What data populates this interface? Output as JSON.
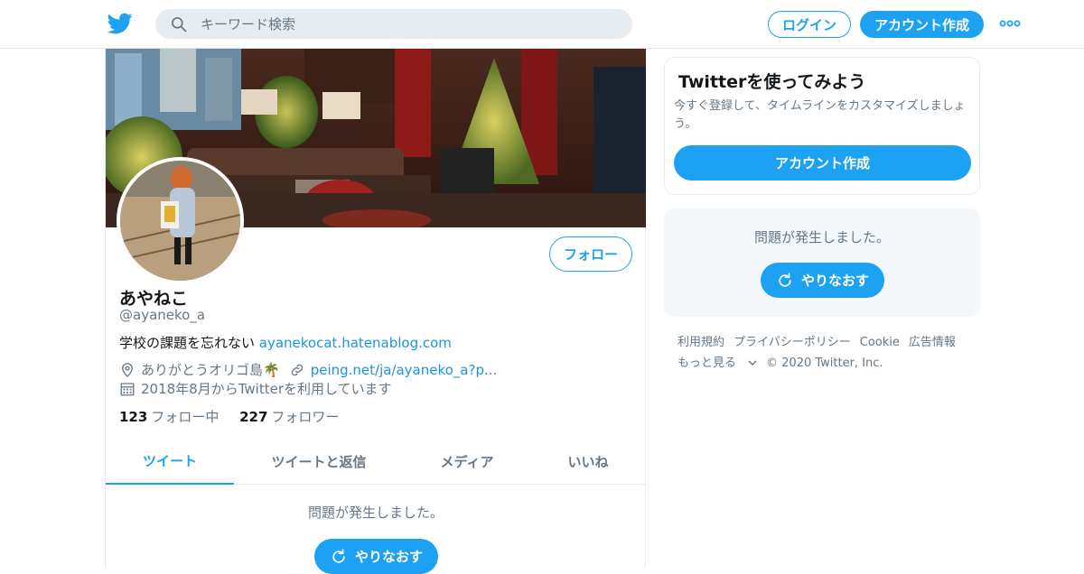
{
  "header": {
    "search_placeholder": "キーワード検索",
    "login_label": "ログイン",
    "signup_label": "アカウント作成"
  },
  "profile": {
    "name": "あやねこ",
    "handle": "@ayaneko_a",
    "bio_text": "学校の課題を忘れない ",
    "bio_link": "ayanekocat.hatenablog.com",
    "location": "ありがとうオリゴ島🌴",
    "website": "peing.net/ja/ayaneko_a?p...",
    "joined": "2018年8月からTwitterを利用しています",
    "following_count": "123",
    "following_label": "フォロー中",
    "followers_count": "227",
    "followers_label": "フォロワー",
    "follow_button": "フォロー"
  },
  "tabs": [
    {
      "label": "ツイート",
      "active": true
    },
    {
      "label": "ツイートと返信",
      "active": false
    },
    {
      "label": "メディア",
      "active": false
    },
    {
      "label": "いいね",
      "active": false
    }
  ],
  "timeline": {
    "error_message": "問題が発生しました。",
    "retry_label": "やりなおす"
  },
  "sidebar": {
    "signup_card": {
      "title": "Twitterを使ってみよう",
      "description": "今すぐ登録して、タイムラインをカスタマイズしましょう。",
      "button": "アカウント作成"
    },
    "error_card": {
      "message": "問題が発生しました。",
      "retry_label": "やりなおす"
    },
    "footer": {
      "terms": "利用規約",
      "privacy": "プライバシーポリシー",
      "cookie": "Cookie",
      "ads": "広告情報",
      "more": "もっと見る",
      "copyright": "© 2020 Twitter, Inc."
    }
  },
  "colors": {
    "accent": "#1da1f2",
    "link": "#1b95e0",
    "secondary_text": "#657786",
    "border": "#e6ecf0"
  },
  "icons": [
    "twitter-bird-icon",
    "search-icon",
    "more-icon",
    "location-icon",
    "link-icon",
    "calendar-icon",
    "refresh-icon",
    "chevron-down-icon"
  ]
}
